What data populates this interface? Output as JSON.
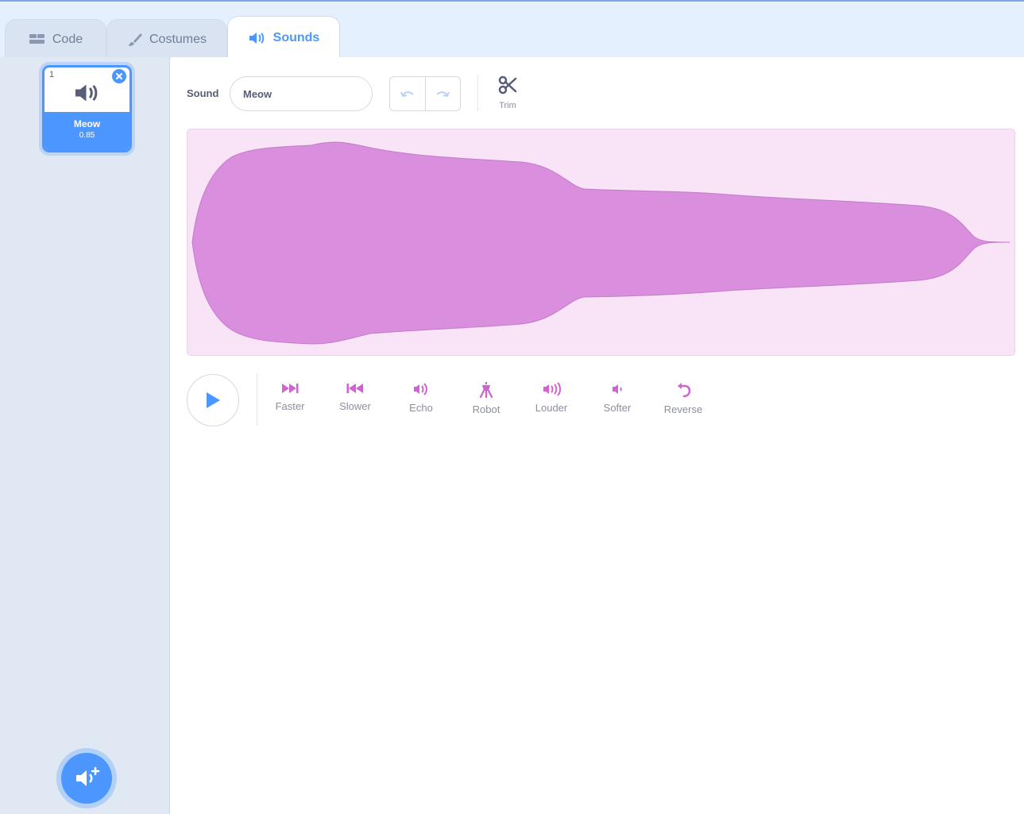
{
  "tabs": [
    {
      "label": "Code",
      "icon": "code-icon",
      "active": false
    },
    {
      "label": "Costumes",
      "icon": "brush-icon",
      "active": false
    },
    {
      "label": "Sounds",
      "icon": "speaker-icon",
      "active": true
    }
  ],
  "sounds_list": [
    {
      "number": "1",
      "name": "Meow",
      "duration": "0.85",
      "icon": "speaker-icon",
      "selected": true
    }
  ],
  "editor": {
    "sound_label": "Sound",
    "sound_name_value": "Meow",
    "undo_icon": "undo-icon",
    "redo_icon": "redo-icon",
    "trim_label": "Trim",
    "trim_icon": "scissors-icon"
  },
  "effects": [
    {
      "label": "Faster",
      "icon": "faster-icon"
    },
    {
      "label": "Slower",
      "icon": "slower-icon"
    },
    {
      "label": "Echo",
      "icon": "echo-icon"
    },
    {
      "label": "Robot",
      "icon": "robot-icon"
    },
    {
      "label": "Louder",
      "icon": "louder-icon"
    },
    {
      "label": "Softer",
      "icon": "softer-icon"
    },
    {
      "label": "Reverse",
      "icon": "reverse-icon"
    }
  ],
  "colors": {
    "accent": "#4c97ff",
    "waveform_fill": "#d98fdd",
    "waveform_background": "#f8e4f6",
    "effect_icon": "#cf63cf"
  }
}
